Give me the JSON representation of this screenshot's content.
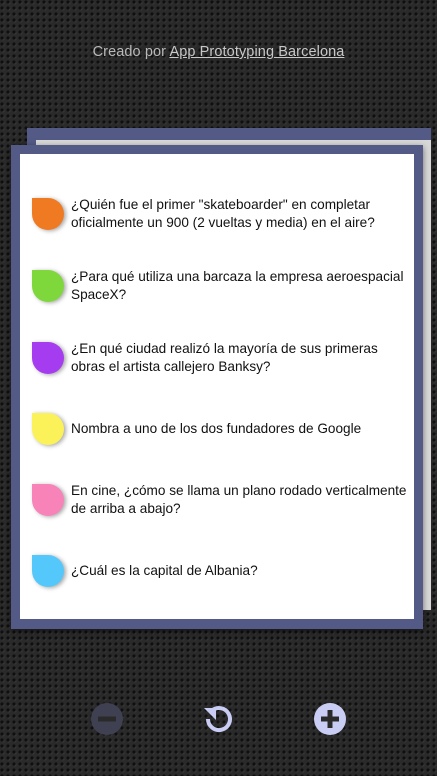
{
  "credit": {
    "prefix": "Creado por ",
    "link": "App Prototyping Barcelona"
  },
  "questions": [
    {
      "color": "#f07a22",
      "text": "¿Quién fue el primer \"skateboarder\" en completar oficialmente un 900 (2 vueltas y media) en el aire?"
    },
    {
      "color": "#7fd83b",
      "text": "¿Para qué utiliza una barcaza la empresa aeroespacial SpaceX?"
    },
    {
      "color": "#a63cf0",
      "text": "¿En qué ciudad realizó la mayoría de sus primeras obras el artista callejero Banksy?"
    },
    {
      "color": "#fbf25a",
      "text": "Nombra a uno de los dos fundadores de Google"
    },
    {
      "color": "#f783b8",
      "text": "En cine, ¿cómo se llama un plano rodado verticalmente de arriba a abajo?"
    },
    {
      "color": "#55c8fb",
      "text": "¿Cuál es la capital de Albania?"
    }
  ],
  "toolbar": {
    "remove_icon": "minus-circle-icon",
    "reload_icon": "refresh-icon",
    "add_icon": "plus-circle-icon",
    "remove_color": "#3f4152",
    "active_color": "#c9cdf4"
  }
}
